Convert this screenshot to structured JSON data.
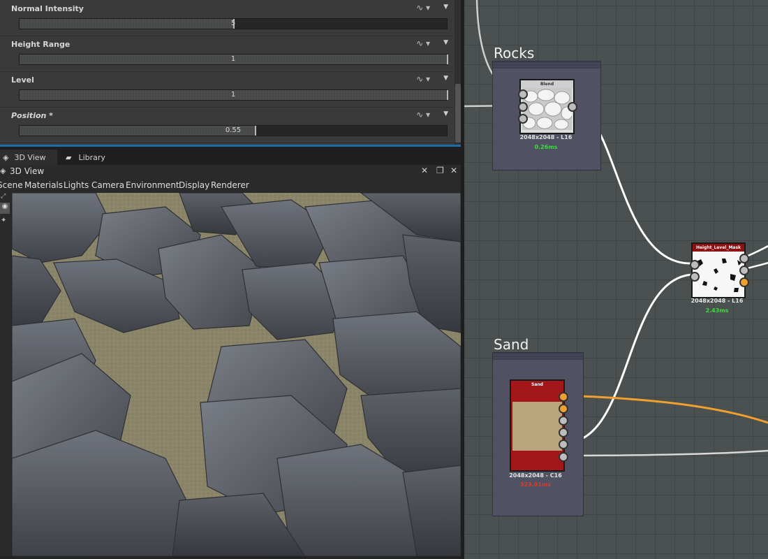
{
  "parameters": [
    {
      "label": "Normal Intensity",
      "value": "5",
      "fill": 0.5,
      "italic": false
    },
    {
      "label": "Height Range",
      "value": "1",
      "fill": 1.0,
      "italic": false
    },
    {
      "label": "Level",
      "value": "1",
      "fill": 1.0,
      "italic": false
    },
    {
      "label": "Position *",
      "value": "0.55",
      "fill": 0.55,
      "italic": true
    }
  ],
  "param_ctrl_icon": "function-curve-icon",
  "tabs": [
    {
      "label": "3D View",
      "icon": "cube-icon",
      "active": true
    },
    {
      "label": "Library",
      "icon": "folder-icon",
      "active": false
    }
  ],
  "view": {
    "title": "3D View",
    "menu": [
      "Scene",
      "Materials",
      "Lights",
      "Camera",
      "Environment",
      "Display",
      "Renderer"
    ]
  },
  "graph": {
    "frames": [
      {
        "title": "Rocks"
      },
      {
        "title": "Sand"
      }
    ],
    "nodes": {
      "blend": {
        "title": "Blend",
        "resolution": "2048x2048 - L16",
        "time": "0.26ms",
        "time_color": "#3bdc3b"
      },
      "height_level_mask": {
        "title": "Height_Level_Mask",
        "resolution": "2048x2048 - L16",
        "time": "2.43ms",
        "time_color": "#3bdc3b"
      },
      "sand": {
        "title": "Sand",
        "resolution": "2048x2048 - C16",
        "time": "323.01ms",
        "time_color": "#e03a2a"
      }
    }
  },
  "colors": {
    "accent_tab": "#1b6ea8",
    "wire_white": "#ffffff",
    "wire_orange": "#f0a030",
    "graph_bg": "#4a5150",
    "frame_bg": "#505264",
    "sand_node_red": "#a3161a",
    "sand_node_tan": "#baa47c"
  }
}
